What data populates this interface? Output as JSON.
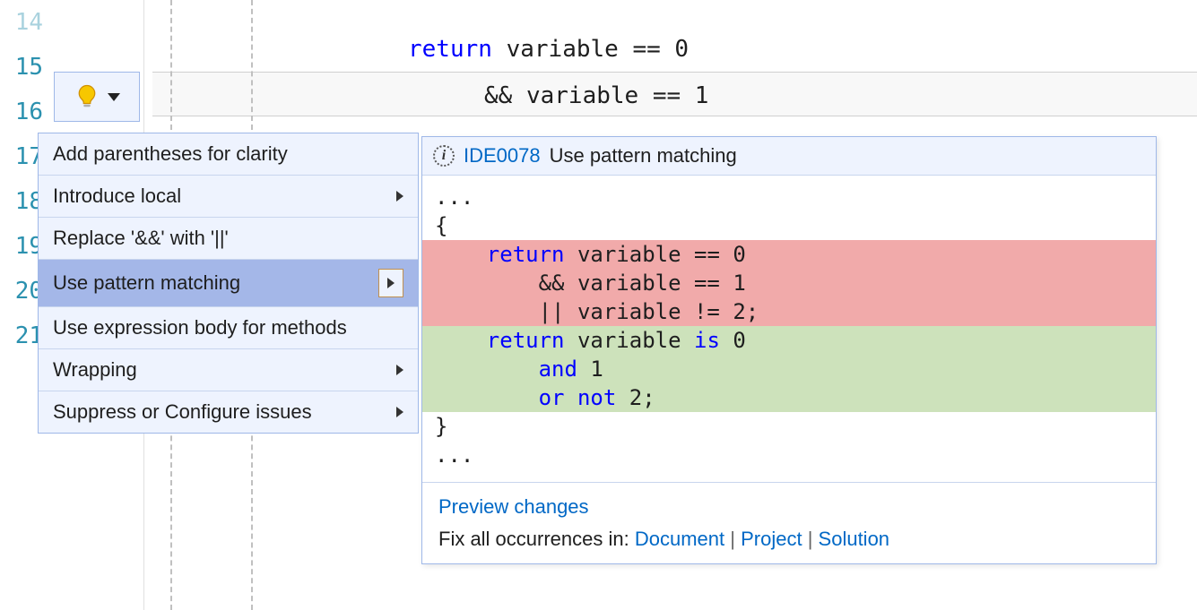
{
  "editor": {
    "line_numbers": [
      "14",
      "15",
      "16",
      "17",
      "18",
      "19",
      "20",
      "21"
    ],
    "code": {
      "line14": "{",
      "line15_kw": "return",
      "line15_rest": " variable == 0",
      "line16": "&& variable == 1"
    }
  },
  "menu": {
    "items": [
      {
        "label": "Add parentheses for clarity",
        "submenu": false
      },
      {
        "label": "Introduce local",
        "submenu": true
      },
      {
        "label": "Replace '&&' with '||'",
        "submenu": false
      },
      {
        "label": "Use pattern matching",
        "submenu": true,
        "selected": true
      },
      {
        "label": "Use expression body for methods",
        "submenu": false
      },
      {
        "label": "Wrapping",
        "submenu": true
      },
      {
        "label": "Suppress or Configure issues",
        "submenu": true
      }
    ]
  },
  "preview": {
    "diagnostic_id": "IDE0078",
    "diagnostic_msg": "Use pattern matching",
    "diff": {
      "context_top1": "...",
      "context_top2": "{",
      "del1_kw": "return",
      "del1_rest": " variable == 0",
      "del2": "        && variable == 1",
      "del3": "        || variable != 2;",
      "add1_kw": "return",
      "add1_rest": " variable ",
      "add1_kw2": "is",
      "add1_rest2": " 0",
      "add2_kw": "and",
      "add2_rest": " 1",
      "add3_kw": "or not",
      "add3_rest": " 2;",
      "context_bot1": "}",
      "context_bot2": "..."
    },
    "footer": {
      "preview_changes": "Preview changes",
      "fix_label": "Fix all occurrences in: ",
      "doc": "Document",
      "proj": "Project",
      "sol": "Solution"
    }
  }
}
